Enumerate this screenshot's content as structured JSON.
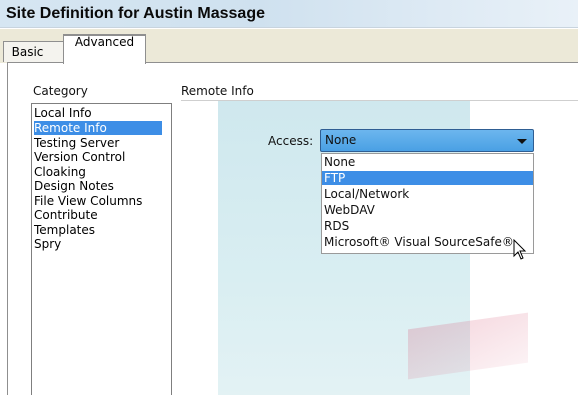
{
  "window": {
    "title": "Site Definition for Austin Massage"
  },
  "tabs": [
    {
      "label": "Basic",
      "selected": false
    },
    {
      "label": "Advanced",
      "selected": true
    }
  ],
  "category": {
    "label": "Category",
    "items": [
      {
        "label": "Local Info"
      },
      {
        "label": "Remote Info",
        "selected": true
      },
      {
        "label": "Testing Server"
      },
      {
        "label": "Version Control"
      },
      {
        "label": "Cloaking"
      },
      {
        "label": "Design Notes"
      },
      {
        "label": "File View Columns"
      },
      {
        "label": "Contribute"
      },
      {
        "label": "Templates"
      },
      {
        "label": "Spry"
      }
    ]
  },
  "section": {
    "title": "Remote Info",
    "access": {
      "label": "Access:",
      "selected_value": "None",
      "options": [
        {
          "label": "None"
        },
        {
          "label": "FTP",
          "highlighted": true
        },
        {
          "label": "Local/Network"
        },
        {
          "label": "WebDAV"
        },
        {
          "label": "RDS"
        },
        {
          "label": "Microsoft® Visual SourceSafe®"
        }
      ]
    }
  },
  "colors": {
    "selection": "#3d8ee6",
    "select_fill": "#5aaae8",
    "background_art": "#d3eaef"
  },
  "icons": {
    "cursor": "mouse-pointer-icon",
    "dropdown_arrow": "chevron-down-icon"
  }
}
